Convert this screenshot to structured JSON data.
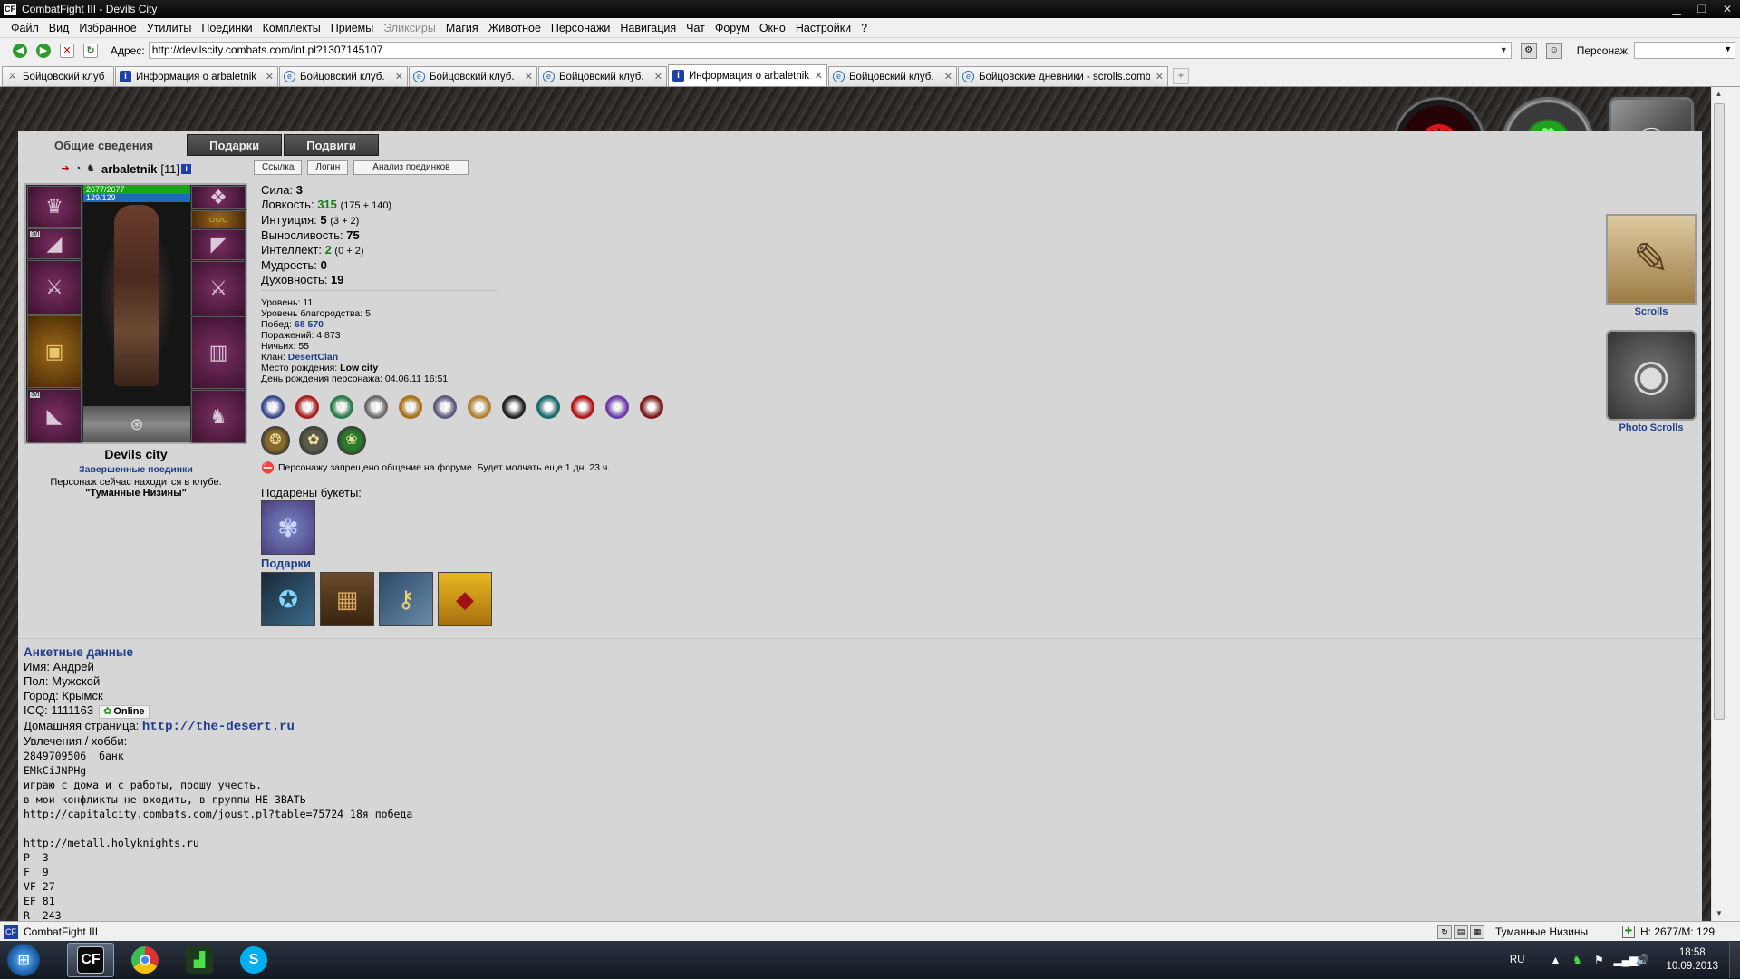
{
  "window": {
    "app_icon": "CF",
    "title": "CombatFight III - Devils City"
  },
  "menu": [
    "Файл",
    "Вид",
    "Избранное",
    "Утилиты",
    "Поединки",
    "Комплекты",
    "Приёмы",
    "Эликсиры",
    "Магия",
    "Животное",
    "Персонажи",
    "Навигация",
    "Чат",
    "Форум",
    "Окно",
    "Настройки",
    "?"
  ],
  "menu_disabled": [
    "Эликсиры"
  ],
  "address": {
    "label": "Адрес:",
    "url": "http://devilscity.combats.com/inf.pl?1307145107",
    "person_label": "Персонаж:",
    "person_value": ""
  },
  "tabs": [
    {
      "label": "Бойцовский клуб",
      "icon": "sword-icon",
      "active": false
    },
    {
      "label": "Информация о arbaletnik",
      "icon": "info-icon",
      "active": false
    },
    {
      "label": "Бойцовский клуб.",
      "icon": "globe-icon",
      "active": false
    },
    {
      "label": "Бойцовский клуб.",
      "icon": "globe-icon",
      "active": false
    },
    {
      "label": "Бойцовский клуб.",
      "icon": "globe-icon",
      "active": false
    },
    {
      "label": "Информация о arbaletnik",
      "icon": "info-icon",
      "active": true
    },
    {
      "label": "Бойцовский клуб.",
      "icon": "globe-icon",
      "active": false
    },
    {
      "label": "Бойцовские дневники - scrolls.comba...",
      "icon": "globe-icon",
      "active": false
    }
  ],
  "subtabs": [
    "Общие сведения",
    "Подарки",
    "Подвиги"
  ],
  "character": {
    "nick": "arbaletnik",
    "level": "[11]",
    "hp": "2677/2677",
    "mp": "129/129",
    "city": "Devils city",
    "finished_link": "Завершенные поединки",
    "location_line": "Персонаж сейчас находится в клубе.",
    "location_name": "\"Туманные Низины\""
  },
  "mini_buttons": [
    "Ссылка",
    "Логин",
    "Анализ поединков"
  ],
  "stats": {
    "str_label": "Сила:",
    "str": "3",
    "agi_label": "Ловкость:",
    "agi": "315",
    "agi_sub": "(175 + 140)",
    "int_label": "Интуиция:",
    "int": "5",
    "int_sub": "(3 + 2)",
    "end_label": "Выносливость:",
    "end": "75",
    "intel_label": "Интеллект:",
    "intel": "2",
    "intel_sub": "(0 + 2)",
    "wis_label": "Мудрость:",
    "wis": "0",
    "spi_label": "Духовность:",
    "spi": "19"
  },
  "info": {
    "level": "Уровень: 11",
    "nobility": "Уровень благородства: 5",
    "wins_label": "Побед:",
    "wins": "68 570",
    "losses": "Поражений: 4 873",
    "draws": "Ничьих: 55",
    "clan_label": "Клан:",
    "clan": "DesertClan",
    "birthplace_label": "Место рождения:",
    "birthplace": "Low city",
    "birthday": "День рождения персонажа: 04.06.11 16:51"
  },
  "medals_row1": [
    "🛡",
    "🛡",
    "🛡",
    "🛡",
    "🛡",
    "🛡",
    "⚙",
    "✦",
    "✺",
    "✹",
    "✧",
    "✸"
  ],
  "medals_row2": [
    "❂",
    "✿",
    "❀"
  ],
  "forum_ban": "Персонажу запрещено общение на форуме. Будет молчать еще 1 дн. 23 ч.",
  "bouquets_label": "Подарены букеты:",
  "gifts_label": "Подарки",
  "profile": {
    "title": "Анкетные данные",
    "name": "Имя: Андрей",
    "sex": "Пол: Мужской",
    "city": "Город: Крымск",
    "icq": "ICQ: 1111163",
    "icq_status": "Online",
    "homepage_label": "Домашняя страница:",
    "homepage": "http://the-desert.ru",
    "hobby_label": "Увлечения / хобби:",
    "hobby_lines": [
      "2849709506  банк",
      "EMkCiJNPHg",
      "играю с дома и с работы, прошу учесть.",
      "в мои конфликты не входить, в группы НЕ ЗВАТЬ",
      "http://capitalcity.combats.com/joust.pl?table=75724 18я победа",
      "",
      "http://metall.holyknights.ru",
      "P  3",
      "F  9",
      "VF 27",
      "EF 81",
      "R  243"
    ]
  },
  "side": {
    "scrolls": "Scrolls",
    "photo_scrolls": "Photo Scrolls"
  },
  "status": {
    "text": "CombatFight III",
    "location": "Туманные Низины",
    "hp": "H: 2677/M: 129"
  },
  "taskbar": {
    "lang": "RU",
    "time": "18:58",
    "date": "10.09.2013"
  },
  "colors": {
    "link": "#1d3f8a",
    "hp": "#1ca31c",
    "mp": "#1c6ab8",
    "content_bg": "#d6d6d6"
  }
}
